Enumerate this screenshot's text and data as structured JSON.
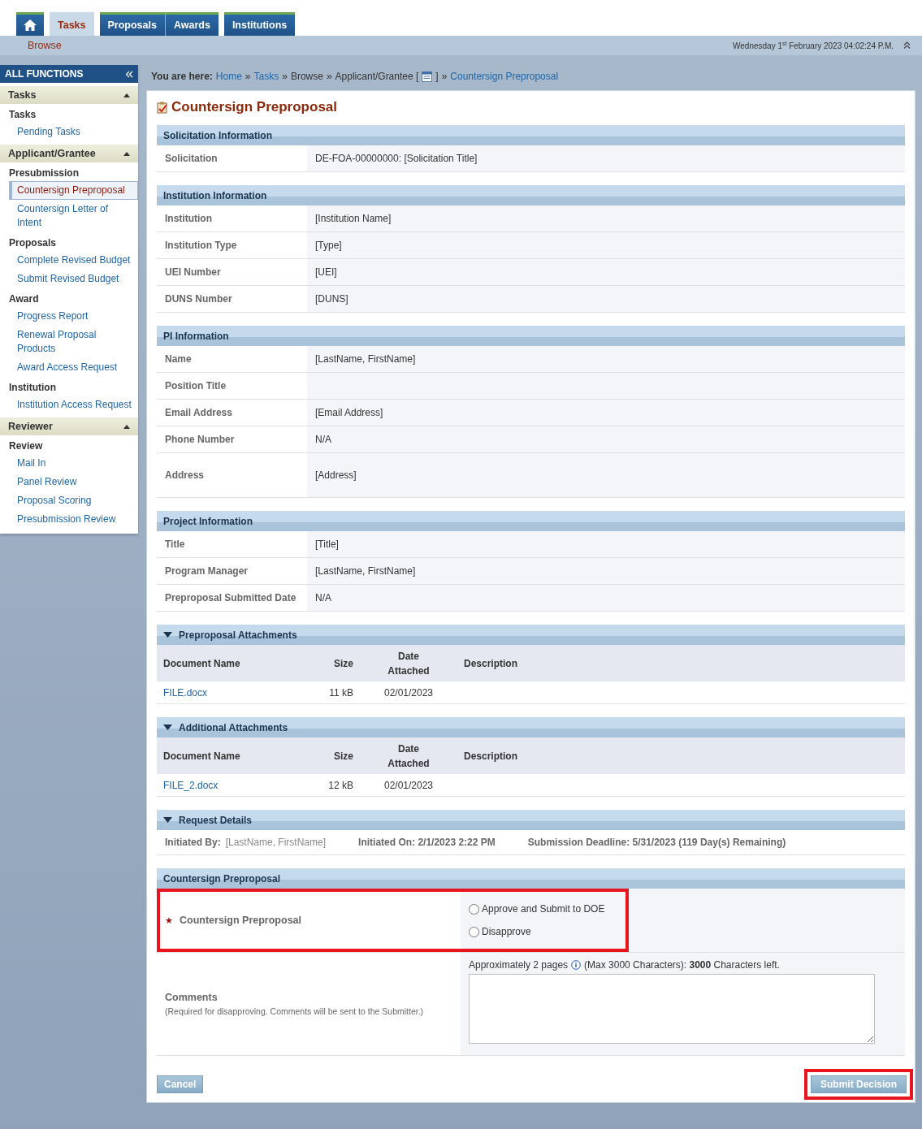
{
  "tabs": [
    {
      "kind": "home",
      "selected": false
    },
    {
      "kind": "text",
      "label": "Tasks",
      "selected": true,
      "joined": false
    },
    {
      "kind": "text",
      "label": "Proposals",
      "selected": false,
      "joined": false
    },
    {
      "kind": "text",
      "label": "Awards",
      "selected": false,
      "joined": true
    },
    {
      "kind": "text",
      "label": "Institutions",
      "selected": false,
      "joined": false
    }
  ],
  "subnav": {
    "label": "Browse",
    "datetime": "Wednesday 1$^{st}$ February 2023 04:02:24 P.M."
  },
  "sidebar": {
    "title": "ALL FUNCTIONS",
    "groups": [
      {
        "title": "Tasks",
        "expanded": true,
        "sections": [
          {
            "heading": "Tasks",
            "items": [
              {
                "label": "Pending Tasks",
                "selected": false
              }
            ]
          }
        ]
      },
      {
        "title": "Applicant/Grantee",
        "expanded": true,
        "sections": [
          {
            "heading": "Presubmission",
            "items": [
              {
                "label": "Countersign Preproposal",
                "selected": true
              },
              {
                "label": "Countersign Letter of Intent",
                "selected": false
              }
            ]
          },
          {
            "heading": "Proposals",
            "items": [
              {
                "label": "Complete Revised Budget",
                "selected": false
              },
              {
                "label": "Submit Revised Budget",
                "selected": false
              }
            ]
          },
          {
            "heading": "Award",
            "items": [
              {
                "label": "Progress Report",
                "selected": false
              },
              {
                "label": "Renewal Proposal Products",
                "selected": false
              },
              {
                "label": "Award Access Request",
                "selected": false
              }
            ]
          },
          {
            "heading": "Institution",
            "items": [
              {
                "label": "Institution Access Request",
                "selected": false
              }
            ]
          }
        ]
      },
      {
        "title": "Reviewer",
        "expanded": true,
        "sections": [
          {
            "heading": "Review",
            "items": [
              {
                "label": "Mail In",
                "selected": false
              },
              {
                "label": "Panel Review",
                "selected": false
              },
              {
                "label": "Proposal Scoring",
                "selected": false
              },
              {
                "label": "Presubmission Review",
                "selected": false
              }
            ]
          }
        ]
      }
    ]
  },
  "breadcrumb": {
    "prefix": "You are here:",
    "separator": "»",
    "items": [
      {
        "kind": "link",
        "label": "Home"
      },
      {
        "kind": "link",
        "label": "Tasks"
      },
      {
        "kind": "text",
        "label": "Browse"
      },
      {
        "kind": "picker",
        "label": "Applicant/Grantee [",
        "after": "]"
      },
      {
        "kind": "link",
        "label": "Countersign Preproposal"
      }
    ]
  },
  "page_title": "Countersign Preproposal",
  "sections": [
    {
      "kind": "fields",
      "title": "Solicitation Information",
      "rows": [
        {
          "label": "Solicitation",
          "value": "DE-FOA-00000000: [Solicitation Title]"
        }
      ]
    },
    {
      "kind": "fields",
      "title": "Institution Information",
      "rows": [
        {
          "label": "Institution",
          "value": "[Institution Name]"
        },
        {
          "label": "Institution Type",
          "value": "[Type]"
        },
        {
          "label": "UEI Number",
          "value": "[UEI]"
        },
        {
          "label": "DUNS Number",
          "value": "[DUNS]"
        }
      ]
    },
    {
      "kind": "fields",
      "title": "PI Information",
      "rows": [
        {
          "label": "Name",
          "value": "[LastName, FirstName]"
        },
        {
          "label": "Position Title"
        },
        {
          "label": "Email Address",
          "value": "[Email Address]"
        },
        {
          "label": "Phone Number",
          "value": "N/A"
        },
        {
          "label": "Address",
          "value": "[Address]",
          "tall": true
        }
      ]
    },
    {
      "kind": "fields",
      "title": "Project Information",
      "rows": [
        {
          "label": "Title",
          "value": "[Title]"
        },
        {
          "label": "Program Manager",
          "value": "[LastName, FirstName]"
        },
        {
          "label": "Preproposal Submitted Date",
          "value": "N/A"
        }
      ]
    },
    {
      "kind": "attachments",
      "title": "Preproposal Attachments",
      "expanded": true,
      "columns": [
        "Document Name",
        "Size",
        "Date Attached",
        "Description"
      ],
      "rows": [
        {
          "name": "FILE.docx",
          "size": "11 kB",
          "date": "02/01/2023"
        }
      ]
    },
    {
      "kind": "attachments",
      "title": "Additional Attachments",
      "expanded": true,
      "columns": [
        "Document Name",
        "Size",
        "Date Attached",
        "Description"
      ],
      "rows": [
        {
          "name": "FILE_2.docx",
          "size": "12 kB",
          "date": "02/01/2023"
        }
      ]
    },
    {
      "kind": "details",
      "title": "Request Details",
      "expanded": true,
      "items": [
        {
          "label": "Initiated By:",
          "value": "[LastName, FirstName]"
        },
        {
          "label": "Initiated On: 2/1/2023  2:22 PM"
        },
        {
          "label": "Submission Deadline: 5/31/2023 (119 Day(s) Remaining)"
        }
      ]
    },
    {
      "kind": "decision",
      "title": "Countersign Preproposal",
      "required_mark": "★",
      "label": "Countersign Preproposal",
      "highlighted": true,
      "options": [
        {
          "label": "Approve and Submit to DOE",
          "selected": false
        },
        {
          "label": "Disapprove",
          "selected": false
        }
      ],
      "comments": {
        "label": "Comments",
        "note": "(Required for disapproving. Comments will be sent to the Submitter.)",
        "hint": "Approximately 2 pages",
        "limit": "(Max 3000 Characters):",
        "count": "3000",
        "count_suffix": "Characters left."
      }
    }
  ],
  "buttons": [
    {
      "kind": "cancel",
      "label": "Cancel",
      "highlighted": false
    },
    {
      "kind": "submit",
      "label": "Submit Decision",
      "highlighted": true
    }
  ]
}
